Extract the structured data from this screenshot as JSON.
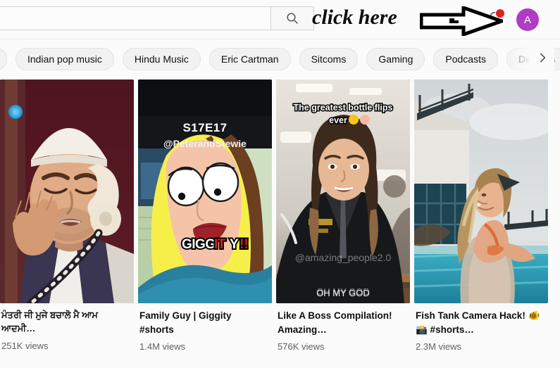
{
  "header": {
    "search": {
      "value": "",
      "placeholder": "",
      "icon": "search-icon",
      "button_label": ""
    },
    "annotation": {
      "text": "click here",
      "arrow_icon": "right-arrow-annotation-icon"
    },
    "notifications": {
      "icon": "bell-icon",
      "has_badge": true,
      "badge_color": "#e02020"
    },
    "avatar": {
      "initial": "A",
      "color": "#b03bc4"
    }
  },
  "chips": {
    "partial_left_label": "",
    "items": [
      {
        "label": "Indian pop music",
        "selected": false
      },
      {
        "label": "Hindu Music",
        "selected": false
      },
      {
        "label": "Eric Cartman",
        "selected": false
      },
      {
        "label": "Sitcoms",
        "selected": false
      },
      {
        "label": "Gaming",
        "selected": false
      },
      {
        "label": "Podcasts",
        "selected": false
      },
      {
        "label": "Debates",
        "selected": false
      }
    ],
    "next_icon": "chevron-right-icon"
  },
  "videos": [
    {
      "title": "ਮੰਤਰੀ ਜੀ ਮੁਜੇ ਬਚਾਲੋ ਮੈ ਆਮ ਆਦਮੀ…",
      "views": "251K views",
      "thumb_overlays": [],
      "thumb_name": "thumbnail-mantri-ji"
    },
    {
      "title": "Family Guy | Giggity #shorts",
      "views": "1.4M views",
      "thumb_overlays": [
        "S17E17",
        "@PeterandStewie",
        "GIGGITY!!"
      ],
      "thumb_name": "thumbnail-family-guy"
    },
    {
      "title": "Like A Boss Compilation! Amazing…",
      "views": "576K views",
      "thumb_overlays": [
        "The greatest bottle flips ever 😂😳",
        "@amazing_people2.0",
        "OH MY GOD"
      ],
      "thumb_name": "thumbnail-like-a-boss"
    },
    {
      "title": "Fish Tank Camera Hack! 🐠📸 #shorts…",
      "views": "2.3M views",
      "thumb_overlays": [],
      "thumb_name": "thumbnail-fish-tank"
    }
  ]
}
